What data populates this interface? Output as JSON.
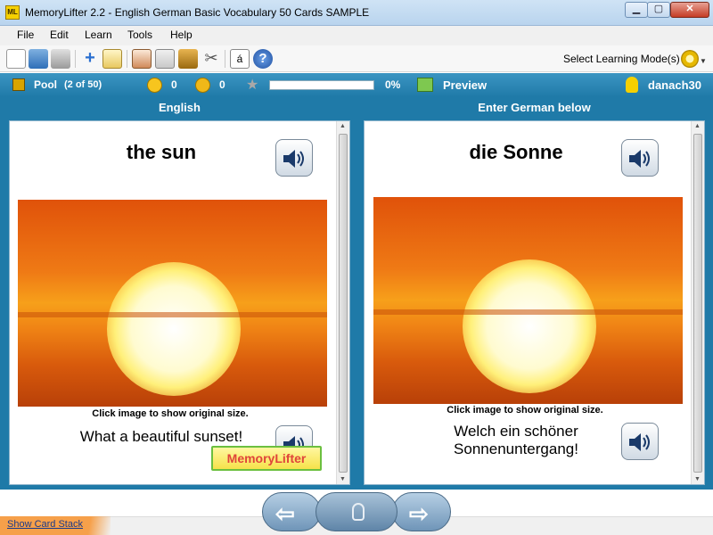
{
  "window": {
    "title": "MemoryLifter 2.2 - English German Basic Vocabulary 50 Cards SAMPLE",
    "icon_text": "ML"
  },
  "menu": {
    "items": [
      "File",
      "Edit",
      "Learn",
      "Tools",
      "Help"
    ]
  },
  "toolbar": {
    "mode_label": "Select Learning Mode(s)"
  },
  "status": {
    "pool_label": "Pool",
    "pool_count": "(2 of 50)",
    "correct_count": "0",
    "wrong_count": "0",
    "progress_percent": 0,
    "progress_text": "0%",
    "preview_label": "Preview",
    "username": "danach30"
  },
  "question": {
    "header": "English",
    "word": "the sun",
    "image_caption": "Click image to show original size.",
    "sentence": "What a beautiful sunset!"
  },
  "answer": {
    "header": "Enter German below",
    "word": "die Sonne",
    "image_caption": "Click image to show original size.",
    "sentence_line1": "Welch ein schöner",
    "sentence_line2": "Sonnenuntergang!"
  },
  "logo": {
    "text": "MemoryLifter"
  },
  "footer": {
    "show_card_stack": "Show Card Stack"
  },
  "colors": {
    "accent": "#1f7aa8",
    "status_bar": "#2d88b6",
    "stack_tab": "#f6a04a"
  }
}
